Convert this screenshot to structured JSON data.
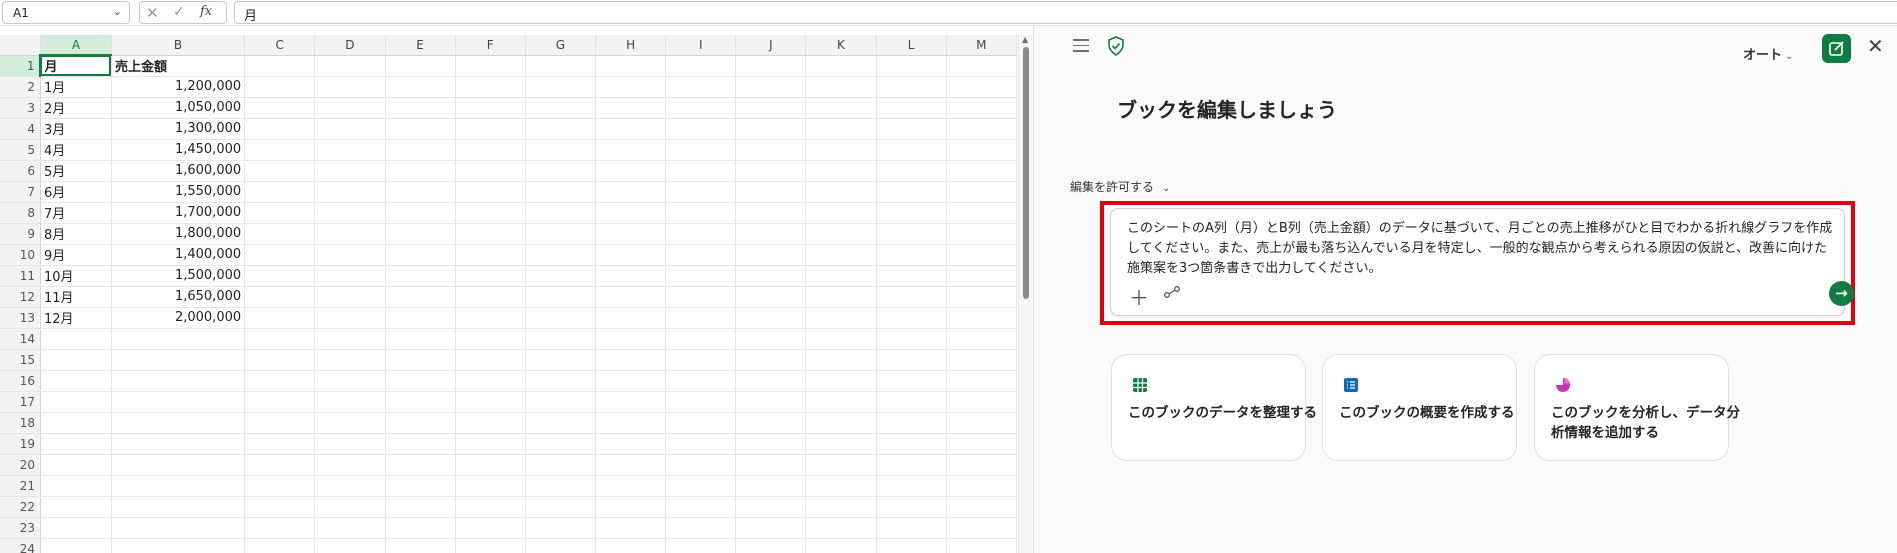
{
  "formula_bar": {
    "name_box": "A1",
    "fx_label": "fx",
    "formula_value": "月"
  },
  "sheet": {
    "columns": [
      "A",
      "B",
      "C",
      "D",
      "E",
      "F",
      "G",
      "H",
      "I",
      "J",
      "K",
      "L",
      "M"
    ],
    "rows": [
      {
        "num": "1",
        "a": "月",
        "b": "売上金額"
      },
      {
        "num": "2",
        "a": "1月",
        "b": "1,200,000"
      },
      {
        "num": "3",
        "a": "2月",
        "b": "1,050,000"
      },
      {
        "num": "4",
        "a": "3月",
        "b": "1,300,000"
      },
      {
        "num": "5",
        "a": "4月",
        "b": "1,450,000"
      },
      {
        "num": "6",
        "a": "5月",
        "b": "1,600,000"
      },
      {
        "num": "7",
        "a": "6月",
        "b": "1,550,000"
      },
      {
        "num": "8",
        "a": "7月",
        "b": "1,700,000"
      },
      {
        "num": "9",
        "a": "8月",
        "b": "1,800,000"
      },
      {
        "num": "10",
        "a": "9月",
        "b": "1,400,000"
      },
      {
        "num": "11",
        "a": "10月",
        "b": "1,500,000"
      },
      {
        "num": "12",
        "a": "11月",
        "b": "1,650,000"
      },
      {
        "num": "13",
        "a": "12月",
        "b": "2,000,000"
      },
      {
        "num": "14",
        "a": "",
        "b": ""
      },
      {
        "num": "15",
        "a": "",
        "b": ""
      },
      {
        "num": "16",
        "a": "",
        "b": ""
      },
      {
        "num": "17",
        "a": "",
        "b": ""
      },
      {
        "num": "18",
        "a": "",
        "b": ""
      },
      {
        "num": "19",
        "a": "",
        "b": ""
      },
      {
        "num": "20",
        "a": "",
        "b": ""
      },
      {
        "num": "21",
        "a": "",
        "b": ""
      },
      {
        "num": "22",
        "a": "",
        "b": ""
      },
      {
        "num": "23",
        "a": "",
        "b": ""
      },
      {
        "num": "24",
        "a": "",
        "b": ""
      }
    ]
  },
  "copilot": {
    "mode_label": "オート",
    "title": "ブックを編集しましょう",
    "permission_label": "編集を許可する",
    "prompt_text": "このシートのA列（月）とB列（売上金額）のデータに基づいて、月ごとの売上推移がひと目でわかる折れ線グラフを作成してください。また、売上が最も落ち込んでいる月を特定し、一般的な観点から考えられる原因の仮説と、改善に向けた施策案を3つ箇条書きで出力してください。",
    "suggestions": [
      {
        "label": "このブックのデータを整理する",
        "icon": "grid-icon",
        "color": "#107c41"
      },
      {
        "label": "このブックの概要を作成する",
        "icon": "list-icon",
        "color": "#0f6cbd"
      },
      {
        "label": "このブックを分析し、データ分析情報を追加する",
        "icon": "chart-pie-icon",
        "color": "#c239b3"
      }
    ],
    "accent_color": "#107c41",
    "highlight_color": "#e0000e"
  }
}
